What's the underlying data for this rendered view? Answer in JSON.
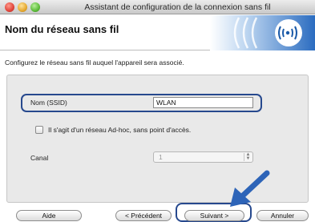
{
  "window": {
    "title": "Assistant de configuration de la connexion sans fil"
  },
  "header": {
    "title": "Nom du réseau sans fil"
  },
  "instructions": "Configurez le réseau sans fil auquel l'appareil sera associé.",
  "form": {
    "ssid_label": "Nom (SSID)",
    "ssid_value": "WLAN",
    "adhoc_label": "Il s'agit d'un réseau Ad-hoc, sans point d'accès.",
    "adhoc_checked": false,
    "canal_label": "Canal",
    "canal_value": "1"
  },
  "buttons": {
    "help": "Aide",
    "previous": "< Précédent",
    "next": "Suivant >",
    "cancel": "Annuler"
  },
  "colors": {
    "highlight": "#27498e",
    "arrow": "#2d64b8",
    "logo_blue": "#1b5aa8"
  },
  "icons": {
    "logo": "wireless-logo-icon",
    "pointer": "pointer-arrow-icon"
  }
}
